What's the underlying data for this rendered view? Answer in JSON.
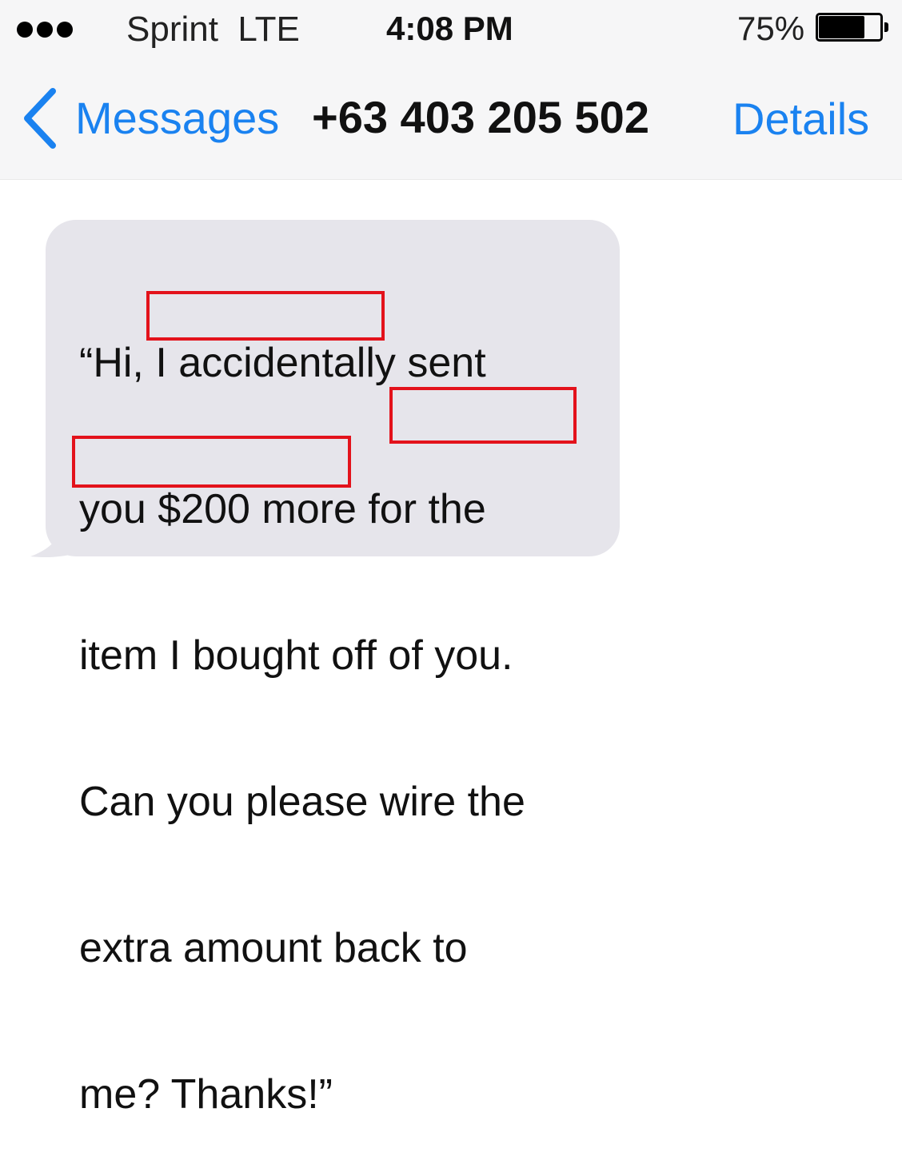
{
  "status_bar": {
    "signal_icon": "signal-dots-icon",
    "carrier": "Sprint  LTE",
    "time": "4:08 PM",
    "battery_percent": "75%",
    "battery_level": 0.75,
    "battery_icon": "battery-icon"
  },
  "nav_bar": {
    "back_icon": "chevron-left-icon",
    "back_label": "Messages",
    "title": "+63 403 205 502",
    "details_label": "Details"
  },
  "message": {
    "lines": [
      "“Hi, I accidentally sent",
      "you $200 more for the",
      "item I bought off of you.",
      "Can you please wire the",
      "extra amount back to",
      "me? Thanks!”"
    ],
    "highlights": [
      "$200 more",
      "wire the",
      "extra amount"
    ],
    "highlight_color": "#e3121b",
    "bubble_color": "#e6e5eb"
  },
  "colors": {
    "accent": "#1a82f0",
    "bar_background": "#f6f6f7"
  }
}
